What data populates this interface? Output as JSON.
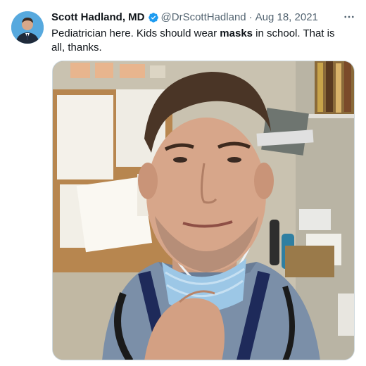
{
  "tweet": {
    "author_name": "Scott Hadland, MD",
    "handle": "@DrScottHadland",
    "separator": "·",
    "date": "Aug 18, 2021",
    "text_before": "Pediatrician here. Kids should wear ",
    "text_bold": "masks",
    "text_after": " in school. That is all, thanks."
  },
  "icons": {
    "verified": "verified-badge-icon",
    "more": "more-options-icon"
  },
  "colors": {
    "verified": "#1d9bf0",
    "name": "#0f1419",
    "secondary": "#536471",
    "border": "#cfd9de"
  }
}
